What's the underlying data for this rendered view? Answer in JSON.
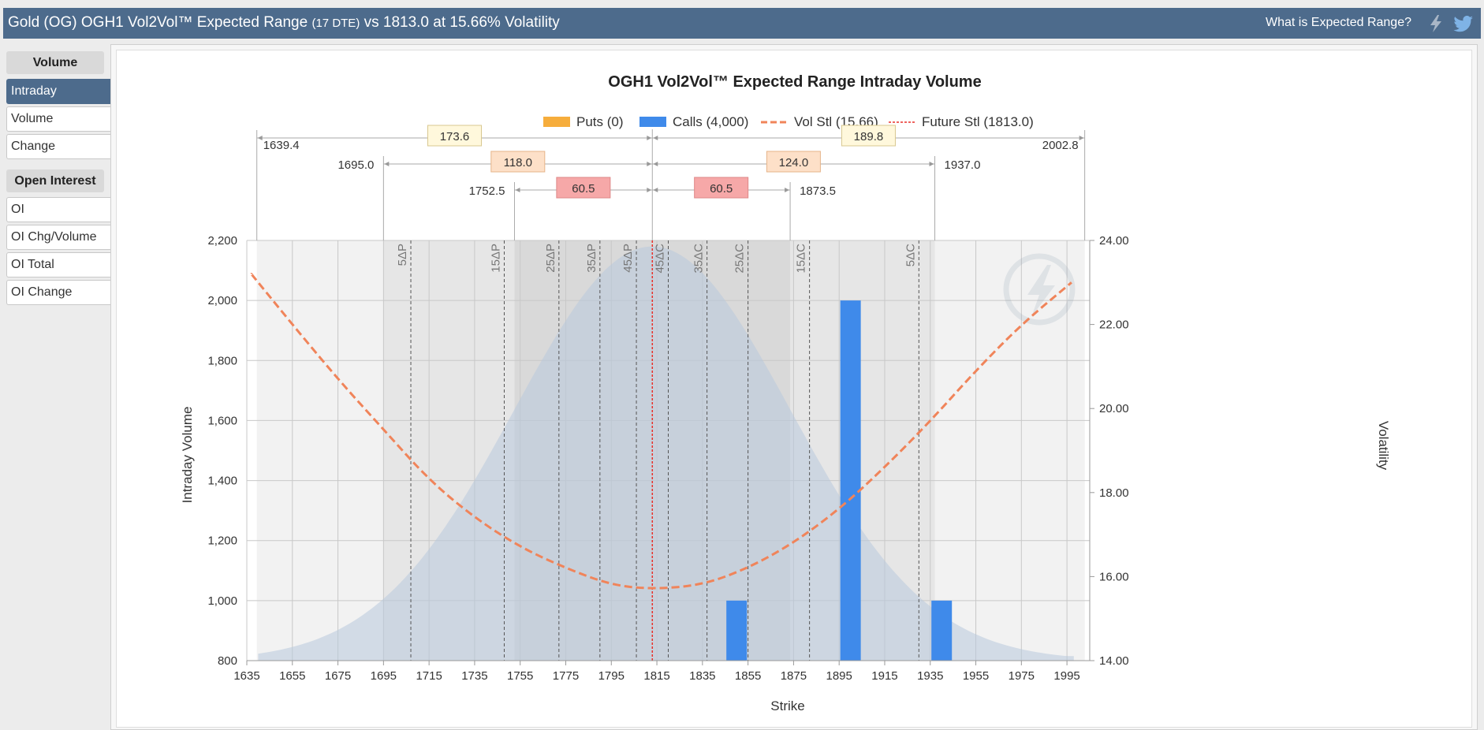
{
  "header": {
    "title_main": "Gold (OG) OGH1 Vol2Vol™ Expected Range",
    "title_dte": "(17 DTE)",
    "title_rest": "vs 1813.0 at 15.66% Volatility",
    "help_link": "What is Expected Range?",
    "icons": [
      "lightning-icon",
      "twitter-icon"
    ]
  },
  "sidebar": {
    "volume_heading": "Volume",
    "volume_items": [
      "Intraday",
      "Volume",
      "Change"
    ],
    "active_item": "Intraday",
    "oi_heading": "Open Interest",
    "oi_items": [
      "OI",
      "OI Chg/Volume",
      "OI Total",
      "OI Change"
    ]
  },
  "colors": {
    "header_bg": "#4d6b8c",
    "puts": "#f6ad3c",
    "calls": "#3f8aea",
    "vol_line": "#f0845a",
    "future_line": "#e8312a"
  },
  "chart_data": {
    "type": "bar",
    "title": "OGH1 Vol2Vol™ Expected Range Intraday Volume",
    "xlabel": "Strike",
    "ylabel": "Intraday Volume",
    "y2label": "Volatility",
    "xlim": [
      1635,
      2005
    ],
    "ylim": [
      800,
      2200
    ],
    "y2lim": [
      14,
      24
    ],
    "x_ticks": [
      1635,
      1655,
      1675,
      1695,
      1715,
      1735,
      1755,
      1775,
      1795,
      1815,
      1835,
      1855,
      1875,
      1895,
      1915,
      1935,
      1955,
      1975,
      1995
    ],
    "y_ticks": [
      "800",
      "1,000",
      "1,200",
      "1,400",
      "1,600",
      "1,800",
      "2,000",
      "2,200"
    ],
    "y_tick_values": [
      800,
      1000,
      1200,
      1400,
      1600,
      1800,
      2000,
      2200
    ],
    "y2_ticks": [
      "14.00",
      "16.00",
      "18.00",
      "20.00",
      "22.00",
      "24.00"
    ],
    "y2_tick_values": [
      14,
      16,
      18,
      20,
      22,
      24
    ],
    "legend": {
      "placement": "top",
      "items": [
        {
          "key": "puts",
          "label": "Puts (0)"
        },
        {
          "key": "calls",
          "label": "Calls (4,000)"
        },
        {
          "key": "vol",
          "label": "Vol Stl (15.66)"
        },
        {
          "key": "future",
          "label": "Future Stl (1813.0)"
        }
      ]
    },
    "series": [
      {
        "name": "Calls",
        "points": [
          {
            "x": 1850,
            "y": 1000
          },
          {
            "x": 1900,
            "y": 2000
          },
          {
            "x": 1940,
            "y": 1000
          }
        ]
      },
      {
        "name": "Puts",
        "points": []
      }
    ],
    "vol_curve": {
      "axis": "y2",
      "points": [
        {
          "x": 1637,
          "y": 23.2
        },
        {
          "x": 1655,
          "y": 22.0
        },
        {
          "x": 1675,
          "y": 20.7
        },
        {
          "x": 1695,
          "y": 19.5
        },
        {
          "x": 1715,
          "y": 18.3
        },
        {
          "x": 1735,
          "y": 17.4
        },
        {
          "x": 1755,
          "y": 16.7
        },
        {
          "x": 1775,
          "y": 16.2
        },
        {
          "x": 1795,
          "y": 15.8
        },
        {
          "x": 1813,
          "y": 15.7
        },
        {
          "x": 1835,
          "y": 15.8
        },
        {
          "x": 1855,
          "y": 16.2
        },
        {
          "x": 1875,
          "y": 16.8
        },
        {
          "x": 1895,
          "y": 17.6
        },
        {
          "x": 1915,
          "y": 18.6
        },
        {
          "x": 1935,
          "y": 19.7
        },
        {
          "x": 1955,
          "y": 20.9
        },
        {
          "x": 1975,
          "y": 22.0
        },
        {
          "x": 1997,
          "y": 23.0
        }
      ]
    },
    "distribution": {
      "center": 1813.0,
      "sd": 60.5,
      "peak": 2180,
      "floor": 800,
      "from": 1640,
      "to": 1998
    },
    "future_settle": 1813.0,
    "expected_ranges": [
      {
        "low": 1639.4,
        "high": 2002.8,
        "low_width": "173.6",
        "high_width": "189.8",
        "low_label": "1639.4",
        "high_label": "2002.8",
        "fill": "#fff8dc",
        "stroke": "#d8c890"
      },
      {
        "low": 1695.0,
        "high": 1937.0,
        "low_width": "118.0",
        "high_width": "124.0",
        "low_label": "1695.0",
        "high_label": "1937.0",
        "fill": "#fde0c8",
        "stroke": "#e6b48a"
      },
      {
        "low": 1752.5,
        "high": 1873.5,
        "low_width": "60.5",
        "high_width": "60.5",
        "low_label": "1752.5",
        "high_label": "1873.5",
        "fill": "#f6a8a8",
        "stroke": "#de8888"
      }
    ],
    "delta_lines": [
      {
        "x": 1707,
        "label": "5ΔP"
      },
      {
        "x": 1748,
        "label": "15ΔP"
      },
      {
        "x": 1772,
        "label": "25ΔP"
      },
      {
        "x": 1790,
        "label": "35ΔP"
      },
      {
        "x": 1806,
        "label": "45ΔP"
      },
      {
        "x": 1820,
        "label": "45ΔC"
      },
      {
        "x": 1837,
        "label": "35ΔC"
      },
      {
        "x": 1855,
        "label": "25ΔC"
      },
      {
        "x": 1882,
        "label": "15ΔC"
      },
      {
        "x": 1930,
        "label": "5ΔC"
      }
    ]
  }
}
